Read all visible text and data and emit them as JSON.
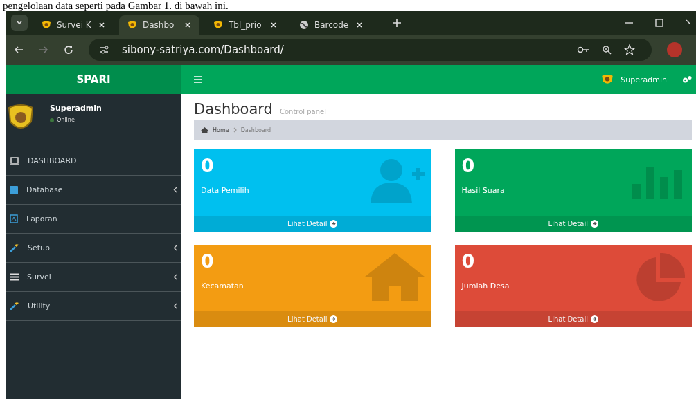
{
  "document_text": "pengelolaan data seperti pada Gambar 1. di bawah ini.",
  "browser": {
    "tabs": [
      {
        "title": "Survei K",
        "kind": "shield",
        "selected": false
      },
      {
        "title": "Dashbo",
        "kind": "shield",
        "selected": true
      },
      {
        "title": "Tbl_prio",
        "kind": "shield",
        "selected": false
      },
      {
        "title": "Barcode",
        "kind": "globe",
        "selected": false
      }
    ],
    "url": "sibony-satriya.com/Dashboard/"
  },
  "header": {
    "brand": "SPARI",
    "user": "Superadmin"
  },
  "sidebar": {
    "user": {
      "name": "Superadmin",
      "status": "Online"
    },
    "items": [
      {
        "label": "DASHBOARD",
        "kind": "laptop",
        "expandable": false
      },
      {
        "label": "Database",
        "kind": "database",
        "expandable": true
      },
      {
        "label": "Laporan",
        "kind": "report",
        "expandable": false
      },
      {
        "label": "Setup",
        "kind": "wrench",
        "expandable": true
      },
      {
        "label": "Survei",
        "kind": "list",
        "expandable": true
      },
      {
        "label": "Utility",
        "kind": "wrench",
        "expandable": true
      }
    ]
  },
  "page": {
    "title": "Dashboard",
    "subtitle": "Control panel",
    "breadcrumb": [
      "Home",
      "Dashboard"
    ]
  },
  "cards": [
    {
      "value": "0",
      "label": "Data Pemilih",
      "link": "Lihat Detail",
      "kind": "user-plus",
      "color": "#00c0ef"
    },
    {
      "value": "0",
      "label": "Hasil Suara",
      "link": "Lihat Detail",
      "kind": "bar-chart",
      "color": "#00a65a"
    },
    {
      "value": "0",
      "label": "Kecamatan",
      "link": "Lihat Detail",
      "kind": "home",
      "color": "#f39c12"
    },
    {
      "value": "0",
      "label": "Jumlah Desa",
      "link": "Lihat Detail",
      "kind": "pie",
      "color": "#dd4b39"
    }
  ]
}
